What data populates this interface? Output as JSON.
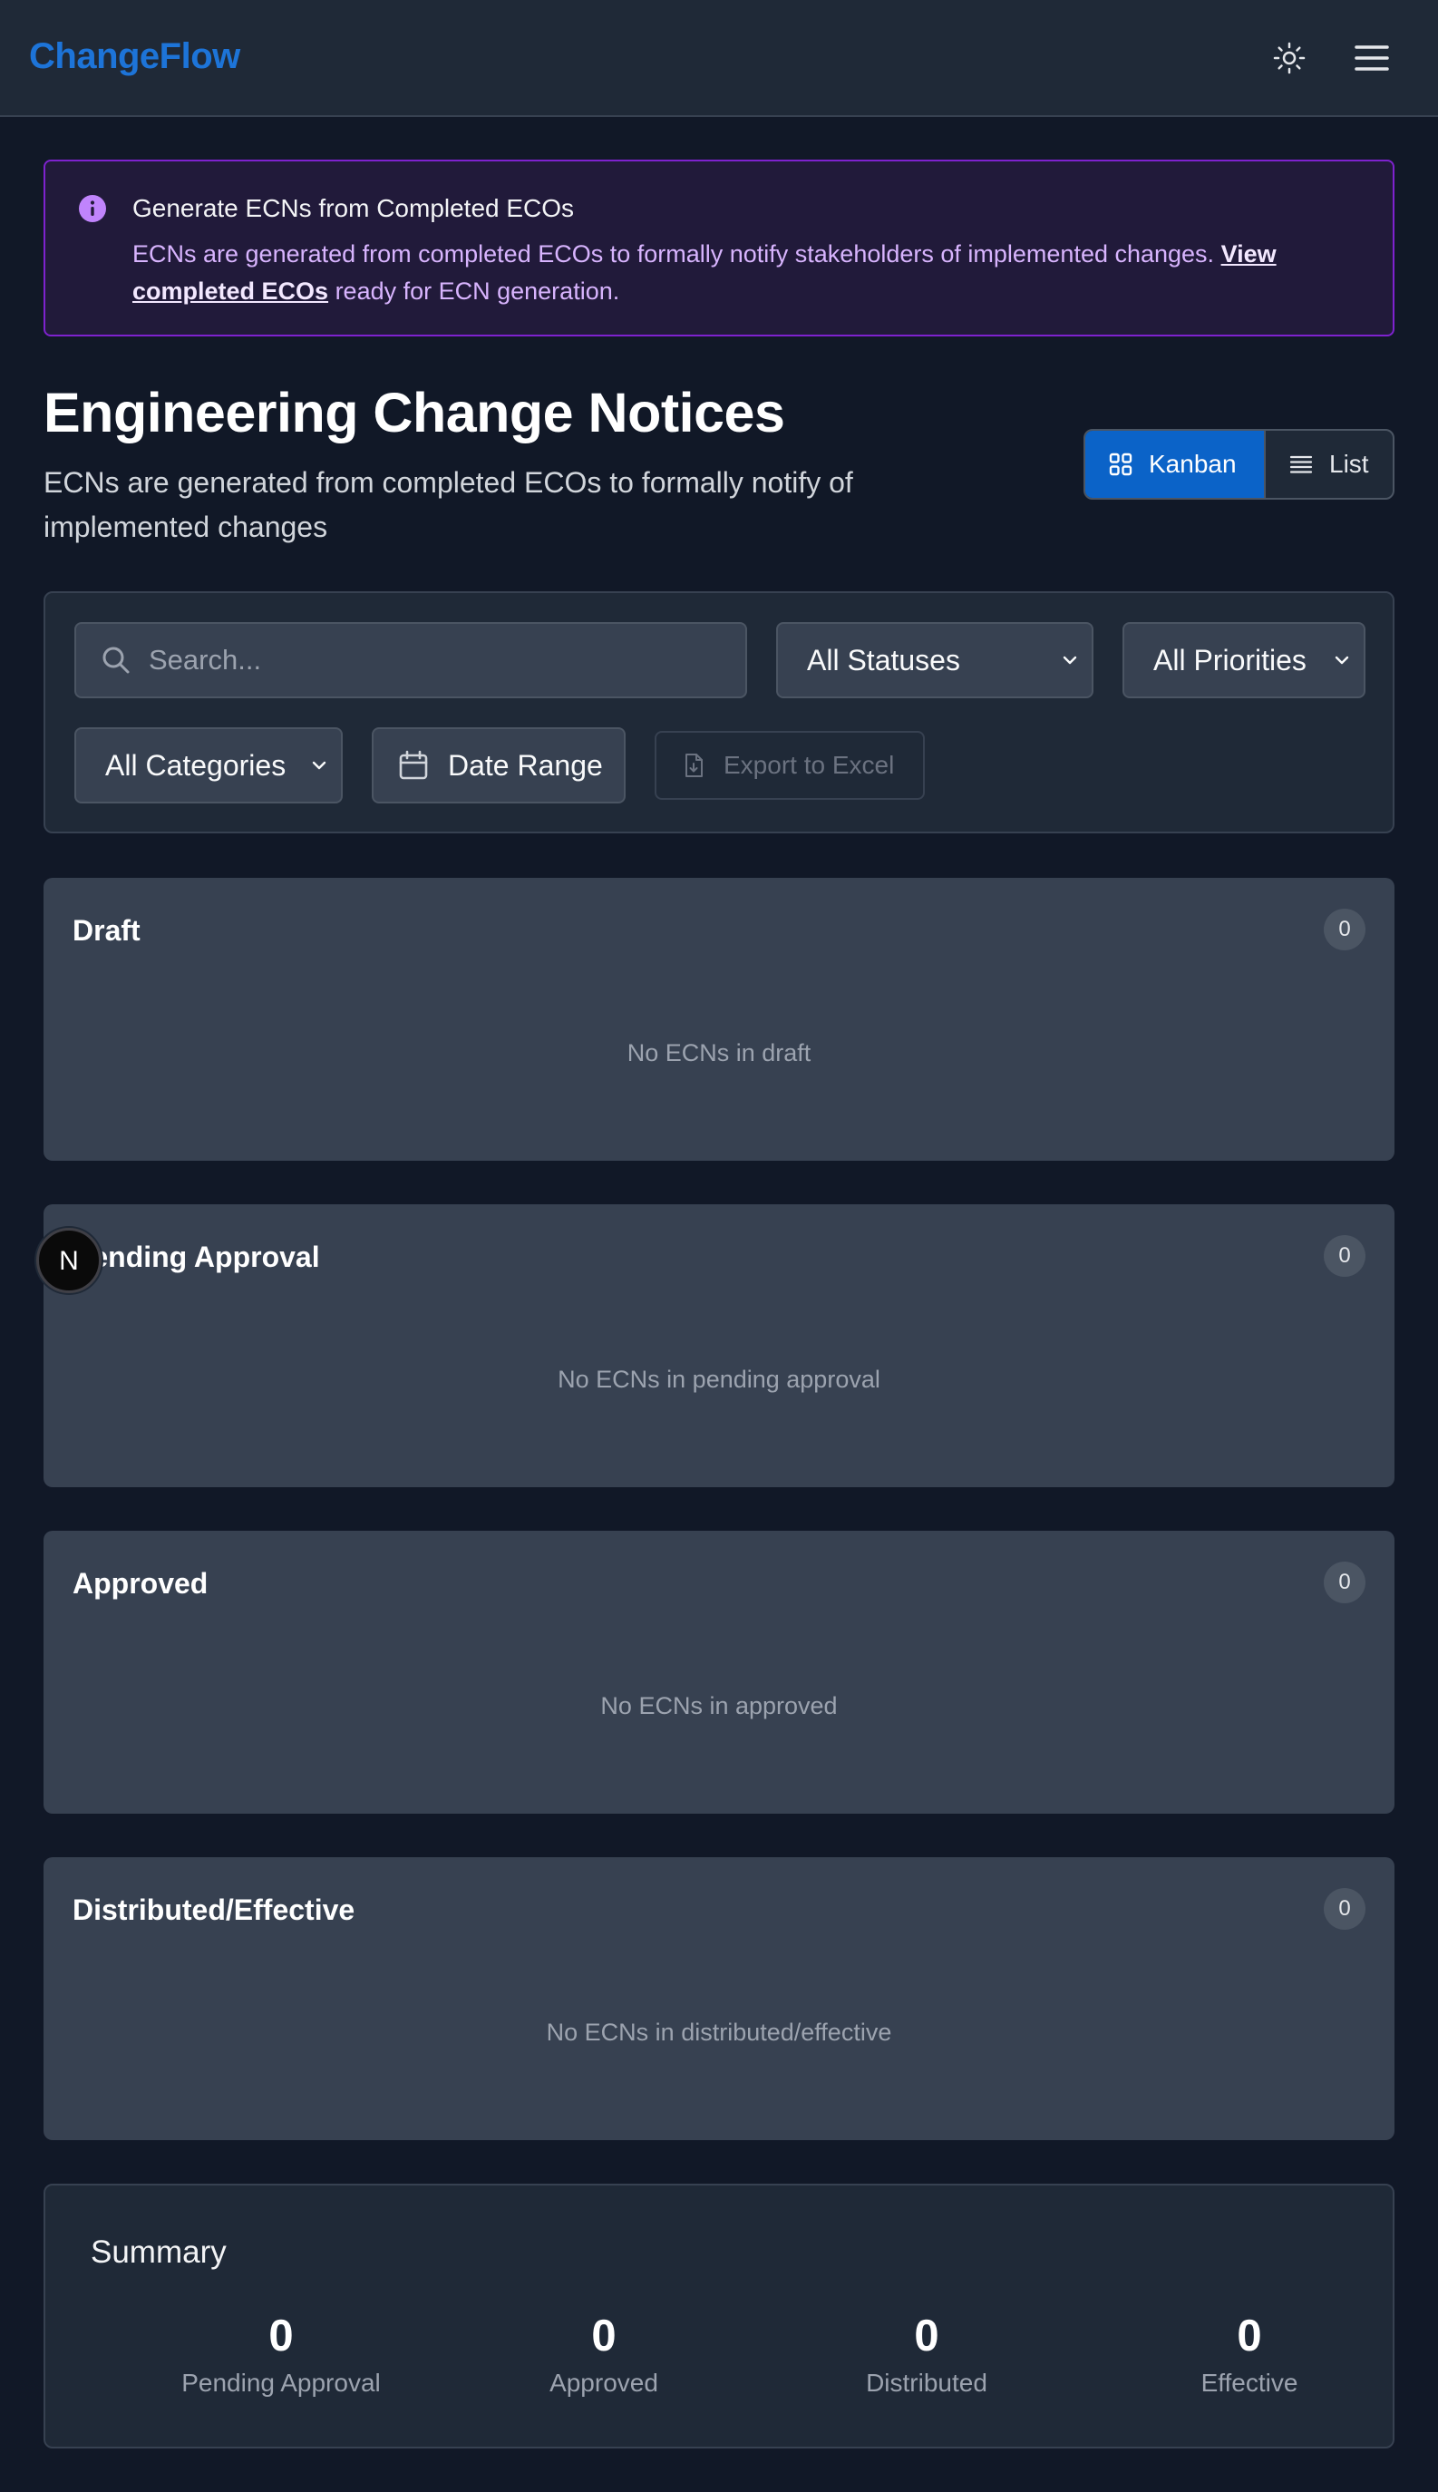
{
  "app": {
    "brand": "ChangeFlow"
  },
  "icons": {
    "theme_toggle": "sun-icon",
    "menu": "hamburger-menu-icon",
    "info": "info-icon",
    "kanban": "grid-icon",
    "list": "list-icon",
    "search": "search-icon",
    "calendar": "calendar-icon",
    "export": "file-download-icon",
    "dev_badge": "nextjs-logo-icon"
  },
  "colors": {
    "brand": "#1d74d8",
    "alert_border": "#7e22ce",
    "alert_text": "#d8b4fe",
    "kanban_active": "#0b63c8"
  },
  "alert": {
    "title": "Generate ECNs from Completed ECOs",
    "body_prefix": "ECNs are generated from completed ECOs to formally notify stakeholders of implemented changes. ",
    "link_text": "View completed ECOs",
    "body_suffix": " ready for ECN generation."
  },
  "page": {
    "title": "Engineering Change Notices",
    "subtitle": "ECNs are generated from completed ECOs to formally notify of implemented changes"
  },
  "view_toggle": {
    "kanban_label": "Kanban",
    "list_label": "List",
    "active": "Kanban"
  },
  "filters": {
    "search_placeholder": "Search...",
    "status_selected": "All Statuses",
    "priority_selected": "All Priorities",
    "category_selected": "All Categories",
    "date_range_label": "Date Range",
    "export_label": "Export to Excel"
  },
  "columns": [
    {
      "title": "Draft",
      "count": "0",
      "empty_text": "No ECNs in draft"
    },
    {
      "title": "Pending Approval",
      "count": "0",
      "empty_text": "No ECNs in pending approval"
    },
    {
      "title": "Approved",
      "count": "0",
      "empty_text": "No ECNs in approved"
    },
    {
      "title": "Distributed/Effective",
      "count": "0",
      "empty_text": "No ECNs in distributed/effective"
    }
  ],
  "dev_badge": {
    "letter": "N"
  },
  "summary": {
    "title": "Summary",
    "stats": [
      {
        "value": "0",
        "label": "Pending Approval"
      },
      {
        "value": "0",
        "label": "Approved"
      },
      {
        "value": "0",
        "label": "Distributed"
      },
      {
        "value": "0",
        "label": "Effective"
      }
    ]
  }
}
